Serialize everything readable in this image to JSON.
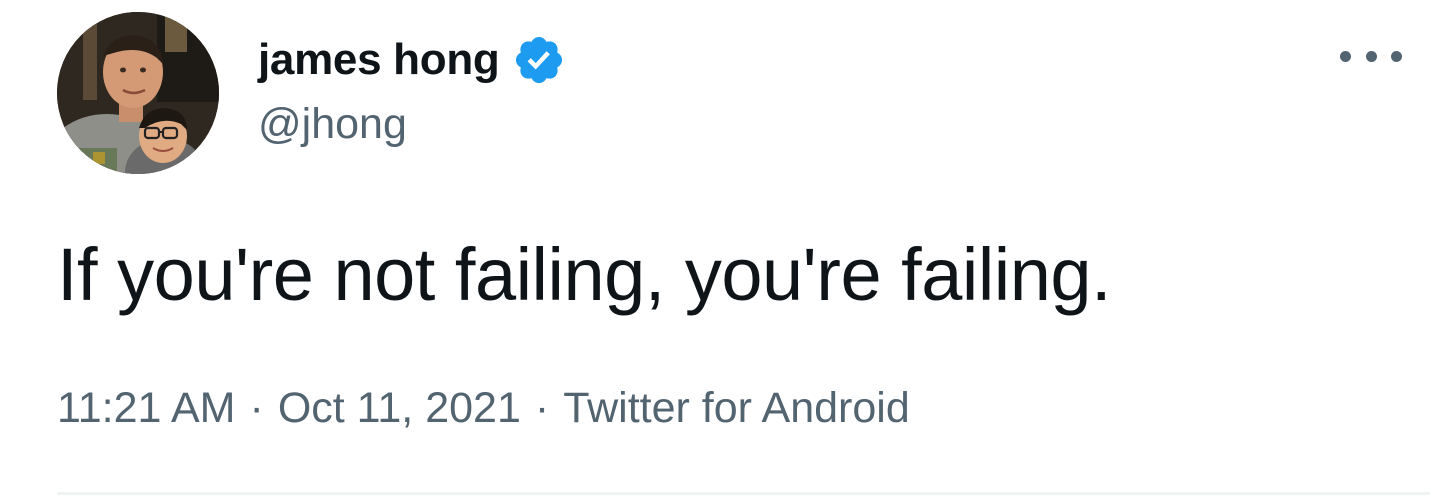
{
  "author": {
    "display_name": "james hong",
    "handle": "@jhong",
    "verified": true
  },
  "tweet": {
    "text": "If you're not failing, you're failing.",
    "time": "11:21 AM",
    "separator": "·",
    "date": "Oct 11, 2021",
    "source": "Twitter for Android"
  },
  "icons": {
    "verified": "verified-badge-icon",
    "more": "more-options-icon"
  },
  "colors": {
    "text_primary": "#0f1419",
    "text_secondary": "#536471",
    "verified_blue": "#1d9bf0",
    "divider": "#eff3f4"
  }
}
